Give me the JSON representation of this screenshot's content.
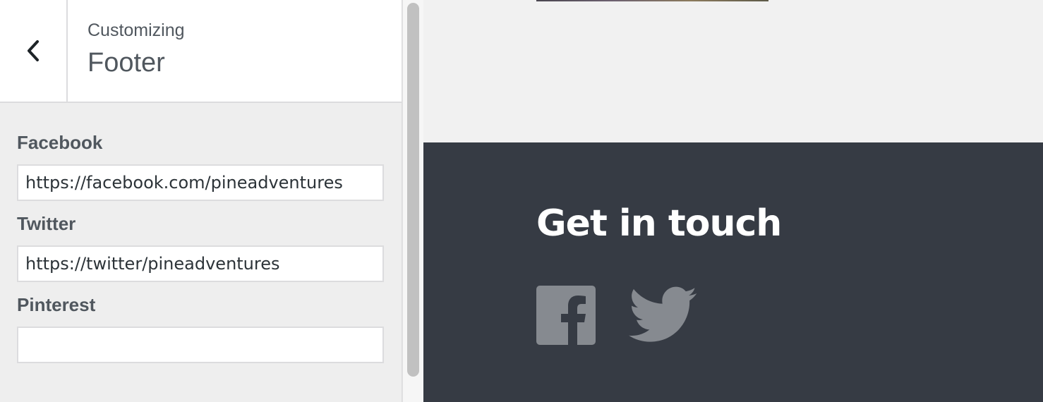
{
  "customizer": {
    "eyebrow": "Customizing",
    "title": "Footer",
    "back_icon": "chevron-left-icon"
  },
  "fields": {
    "facebook": {
      "label": "Facebook",
      "value": "https://facebook.com/pineadventures",
      "placeholder": ""
    },
    "twitter": {
      "label": "Twitter",
      "value": "https://twitter/pineadventures",
      "placeholder": ""
    },
    "pinterest": {
      "label": "Pinterest",
      "value": "",
      "placeholder": ""
    }
  },
  "preview": {
    "footer_heading": "Get in touch",
    "social_icons": [
      "facebook-icon",
      "twitter-icon"
    ]
  },
  "colors": {
    "footer_background": "#363b44",
    "social_icon": "#868a90",
    "label_text": "#50575e"
  }
}
